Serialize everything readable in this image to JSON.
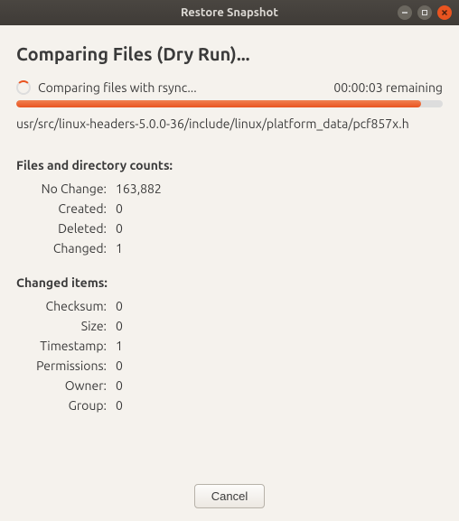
{
  "window": {
    "title": "Restore Snapshot"
  },
  "heading": "Comparing Files (Dry Run)...",
  "status": {
    "text": "Comparing files with rsync...",
    "time": "00:00:03 remaining"
  },
  "current_file": "usr/src/linux-headers-5.0.0-36/include/linux/platform_data/pcf857x.h",
  "file_counts": {
    "heading": "Files and directory counts:",
    "no_change": {
      "label": "No Change:",
      "value": "163,882"
    },
    "created": {
      "label": "Created:",
      "value": "0"
    },
    "deleted": {
      "label": "Deleted:",
      "value": "0"
    },
    "changed": {
      "label": "Changed:",
      "value": "1"
    }
  },
  "changed_items": {
    "heading": "Changed items:",
    "checksum": {
      "label": "Checksum:",
      "value": "0"
    },
    "size": {
      "label": "Size:",
      "value": "0"
    },
    "timestamp": {
      "label": "Timestamp:",
      "value": "1"
    },
    "permissions": {
      "label": "Permissions:",
      "value": "0"
    },
    "owner": {
      "label": "Owner:",
      "value": "0"
    },
    "group": {
      "label": "Group:",
      "value": "0"
    }
  },
  "buttons": {
    "cancel": "Cancel"
  }
}
